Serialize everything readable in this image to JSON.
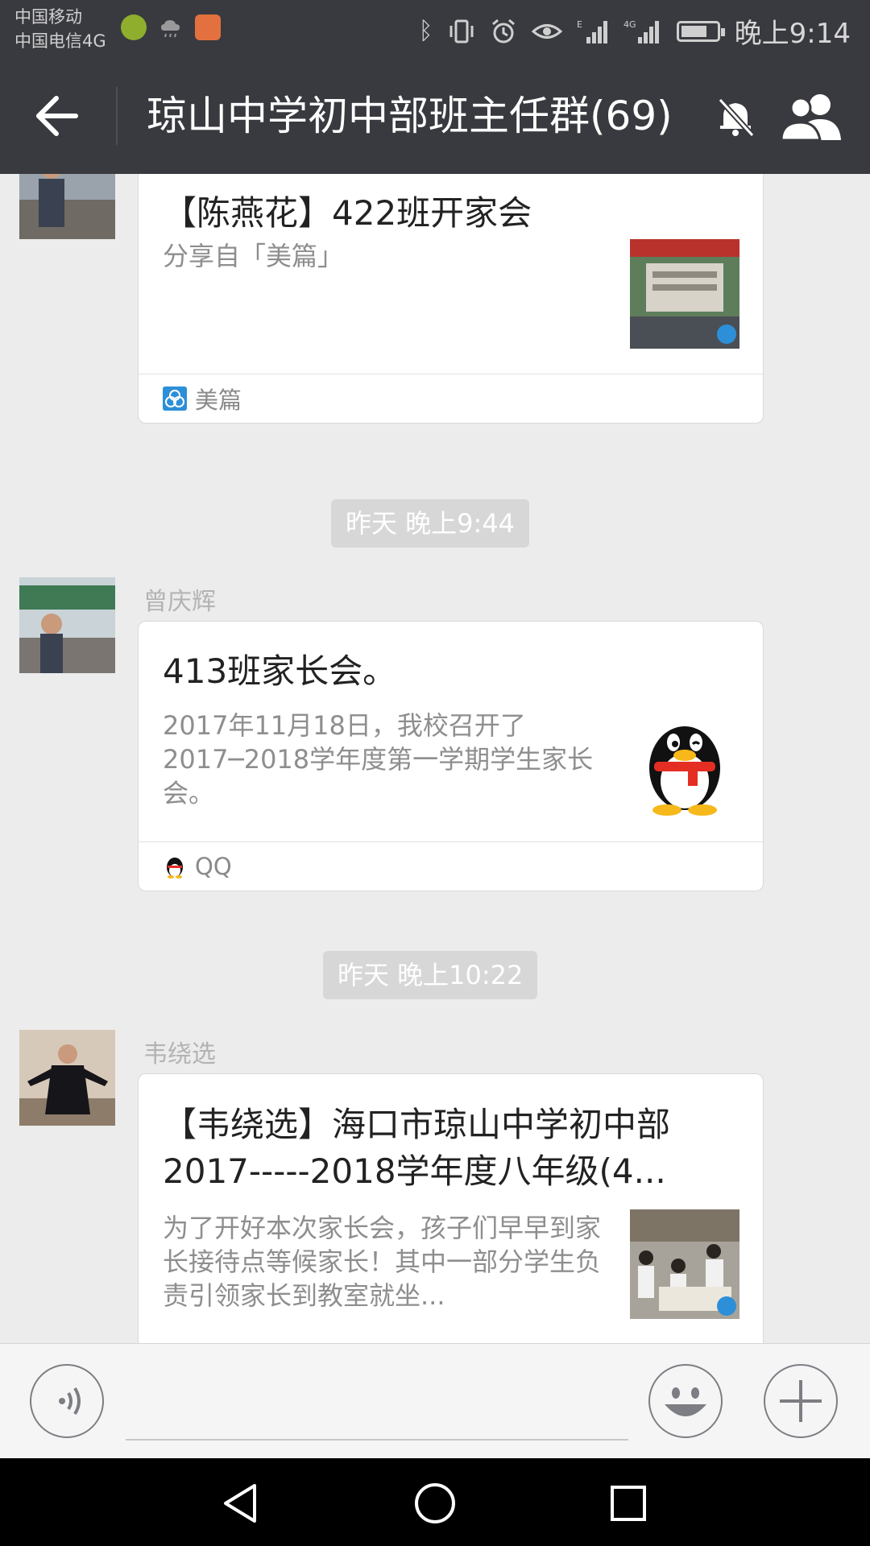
{
  "status_bar": {
    "carrier_1": "中国移动",
    "carrier_2": "中国电信4G",
    "time": "晚上9:14",
    "battery_level": 0.75
  },
  "header": {
    "title": "琼山中学初中部班主任群(69)",
    "back_icon": "back-arrow-icon",
    "mute_icon": "bell-muted-icon",
    "members_icon": "group-members-icon"
  },
  "messages": [
    {
      "type": "link_card",
      "title": "【陈燕花】422班开家会",
      "description": "分享自「美篇」",
      "source": "美篇",
      "source_icon": "meipian-icon",
      "thumb": "school-gate-photo"
    },
    {
      "type": "timestamp",
      "text": "昨天 晚上9:44"
    },
    {
      "type": "link_card",
      "sender": "曾庆辉",
      "title": "413班家长会。",
      "description": "2017年11月18日，我校召开了2017─2018学年度第一学期学生家长会。",
      "source": "QQ",
      "source_icon": "qq-penguin-icon",
      "thumb": "qq-penguin-logo"
    },
    {
      "type": "timestamp",
      "text": "昨天 晚上10:22"
    },
    {
      "type": "link_card",
      "sender": "韦绕选",
      "title": "【韦绕选】海口市琼山中学初中部2017-----2018学年度八年级(4...",
      "description": "为了开好本次家长会，孩子们早早到家长接待点等候家长！其中一部分学生负责引领家长到教室就坐...",
      "thumb": "students-photo"
    }
  ],
  "input_bar": {
    "voice_icon": "voice-icon",
    "emoji_icon": "emoji-icon",
    "plus_icon": "plus-icon"
  },
  "nav_bar": {
    "back_icon": "nav-back-icon",
    "home_icon": "nav-home-icon",
    "recents_icon": "nav-recents-icon"
  },
  "colors": {
    "header_bg": "#393a3f",
    "chat_bg": "#ececec",
    "card_bg": "#ffffff",
    "timestamp_bg": "#d7d7d7"
  }
}
